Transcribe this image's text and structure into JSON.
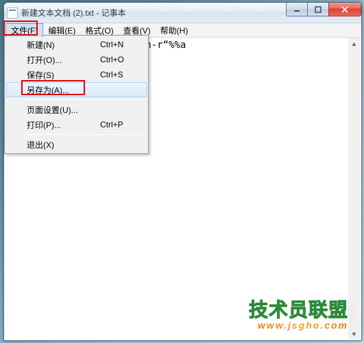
{
  "title": "新建文本文档 (2).txt - 记事本",
  "menus": {
    "file": "文件(F)",
    "edit": "编辑(E)",
    "format": "格式(O)",
    "view": "查看(V)",
    "help": "帮助(H)"
  },
  "dropdown": {
    "new": {
      "label": "新建(N)",
      "shortcut": "Ctrl+N"
    },
    "open": {
      "label": "打开(O)...",
      "shortcut": "Ctrl+O"
    },
    "save": {
      "label": "保存(S)",
      "shortcut": "Ctrl+S"
    },
    "saveas": {
      "label": "另存为(A)...",
      "shortcut": ""
    },
    "pagesetup": {
      "label": "页面设置(U)...",
      "shortcut": ""
    },
    "print": {
      "label": "打印(P)...",
      "shortcut": "Ctrl+P"
    },
    "exit": {
      "label": "退出(X)",
      "shortcut": ""
    }
  },
  "document_text": "(‘dir/a/b’)doattrib-a-s-h-r“%%a",
  "watermark": {
    "brand": "技术员联盟",
    "url": "www.jsgho.com"
  }
}
